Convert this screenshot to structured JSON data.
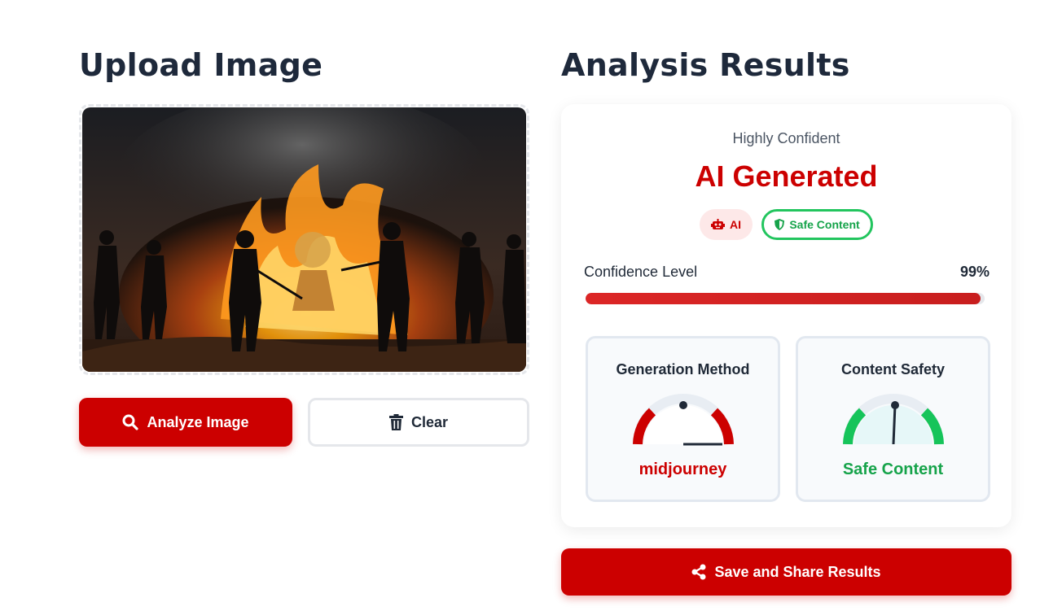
{
  "upload": {
    "heading": "Upload Image"
  },
  "actions": {
    "analyze_label": "Analyze Image",
    "clear_label": "Clear",
    "share_label": "Save and Share Results"
  },
  "results": {
    "heading": "Analysis Results",
    "confidence_caption": "Highly Confident",
    "verdict": "AI Generated",
    "badges": [
      {
        "label": "AI",
        "icon": "robot-icon"
      },
      {
        "label": "Safe Content",
        "icon": "shield-icon"
      }
    ],
    "confidence": {
      "label": "Confidence Level",
      "value_text": "99%",
      "value": 99
    },
    "metrics": [
      {
        "title": "Generation Method",
        "value": "midjourney",
        "gauge_color": "#cc0000"
      },
      {
        "title": "Content Safety",
        "value": "Safe Content",
        "gauge_color": "#16a34a"
      }
    ]
  },
  "colors": {
    "accent": "#cc0000",
    "safe": "#16a34a",
    "heading": "#1e293b"
  }
}
